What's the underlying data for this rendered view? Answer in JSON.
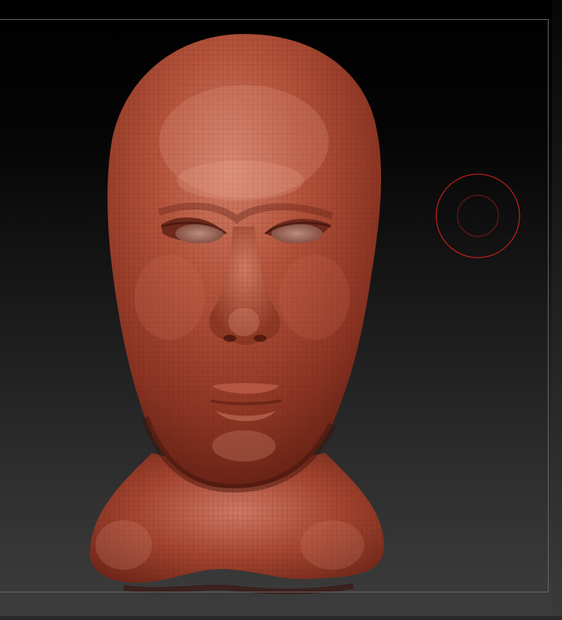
{
  "viewport": {
    "colors": {
      "background_top": "#000000",
      "background_bottom": "#3d3d3d",
      "frame_border": "#6a6a6a",
      "sculpt_material": "#a8452f",
      "brush_cursor": "#c0201c"
    },
    "model": {
      "icon": "sculpted-head-mesh"
    },
    "brush": {
      "icon": "brush-cursor-icon"
    }
  }
}
